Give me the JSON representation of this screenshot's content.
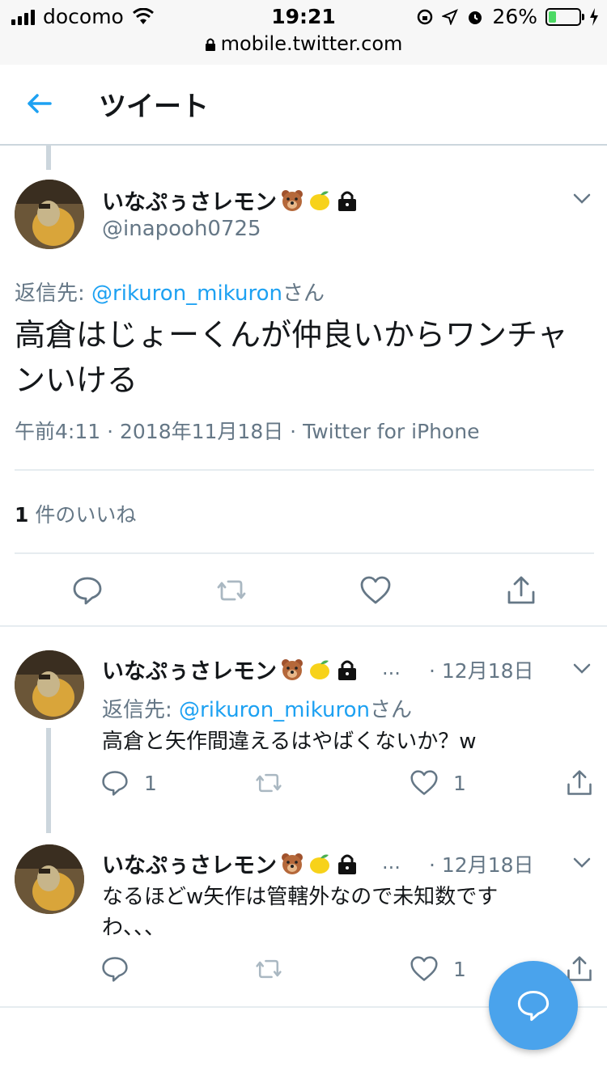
{
  "status_bar": {
    "carrier": "docomo",
    "time": "19:21",
    "battery": "26%",
    "battery_level": 0.26,
    "url": "mobile.twitter.com"
  },
  "header": {
    "title": "ツイート",
    "back_icon": "arrow-left-icon"
  },
  "main_tweet": {
    "display_name": "いなぷぅさレモン",
    "name_icons": [
      "bear-emoji",
      "lemon-emoji",
      "lock-icon"
    ],
    "handle": "@inapooh0725",
    "reply_to_label": "返信先:",
    "reply_to_mention": "@rikuron_mikuron",
    "reply_to_suffix": "さん",
    "text": "高倉はじょーくんが仲良いからワンチャンいける",
    "timestamp": "午前4:11 · 2018年11月18日 · Twitter for iPhone",
    "likes_count": "1",
    "likes_unit": "件の",
    "likes_label": "いいね"
  },
  "replies": [
    {
      "display_name": "いなぷぅさレモン",
      "ellipsis": "...",
      "date": "· 12月18日",
      "reply_to_label": "返信先:",
      "reply_to_mention": "@rikuron_mikuron",
      "reply_to_suffix": "さん",
      "text": "高倉と矢作間違えるはやばくないか？w",
      "reply_count": "1",
      "like_count": "1"
    },
    {
      "display_name": "いなぷぅさレモン",
      "ellipsis": "...",
      "date": "· 12月18日",
      "text": "なるほどw矢作は管轄外なので未知数ですわ、、、",
      "like_count": "1"
    }
  ],
  "colors": {
    "accent": "#1da1f2",
    "muted": "#657786",
    "fab": "#4aa3ec"
  }
}
